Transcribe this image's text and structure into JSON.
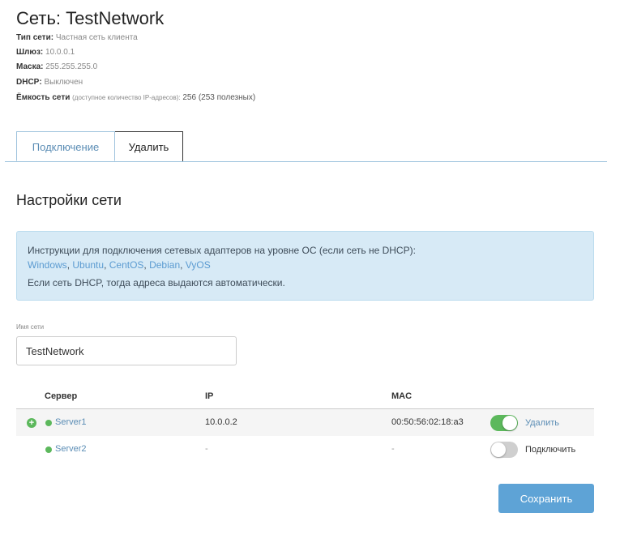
{
  "header": {
    "title": "Сеть: TestNetwork",
    "type_label": "Тип сети:",
    "type_value": "Частная сеть клиента",
    "gateway_label": "Шлюз:",
    "gateway_value": "10.0.0.1",
    "mask_label": "Маска:",
    "mask_value": "255.255.255.0",
    "dhcp_label": "DHCP:",
    "dhcp_value": "Выключен",
    "capacity_label": "Ёмкость сети",
    "capacity_hint": "(доступное количество IP-адресов):",
    "capacity_value": "256 (253 полезных)"
  },
  "tabs": [
    {
      "label": "Подключение",
      "active": true
    },
    {
      "label": "Удалить",
      "active": false
    }
  ],
  "section": {
    "title": "Настройки сети"
  },
  "info": {
    "line1": "Инструкции для подключения сетевых адаптеров на уровне ОС (если сеть не DHCP):",
    "links": [
      "Windows",
      "Ubuntu",
      "CentOS",
      "Debian",
      "VyOS"
    ],
    "link_sep": ", ",
    "line3": "Если сеть DHCP, тогда адреса выдаются автоматически."
  },
  "form": {
    "name_label": "Имя сети",
    "name_value": "TestNetwork"
  },
  "table": {
    "columns": [
      "Сервер",
      "IP",
      "MAC"
    ],
    "rows": [
      {
        "server": "Server1",
        "ip": "10.0.0.2",
        "mac": "00:50:56:02:18:a3",
        "connected": true,
        "action": "Удалить"
      },
      {
        "server": "Server2",
        "ip": "-",
        "mac": "-",
        "connected": false,
        "action": "Подключить"
      }
    ]
  },
  "actions": {
    "save_label": "Сохранить"
  },
  "colors": {
    "accent": "#5ea3d6",
    "link": "#5b8db5",
    "status_green": "#5cb85c",
    "info_bg": "#d7eaf6",
    "toggle_off": "#cfcfcf"
  },
  "icons": {
    "add": "plus-circle-icon",
    "status": "status-dot-icon"
  }
}
